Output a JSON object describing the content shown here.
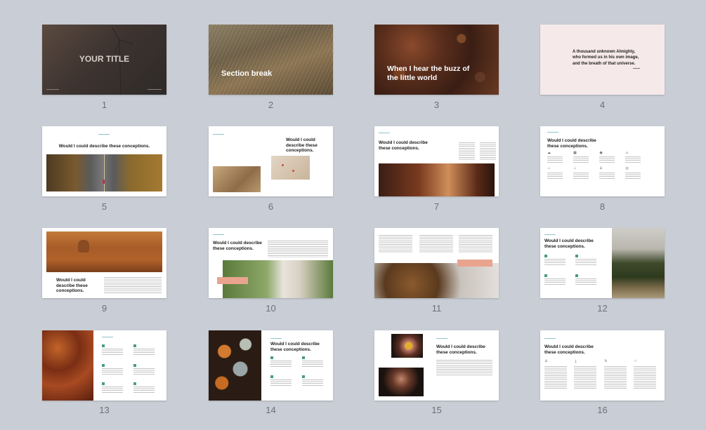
{
  "colors": {
    "background": "#c9ced6",
    "accent": "#4aa9b5",
    "bullet": "#4a9c7a",
    "callout": "#e9a48e"
  },
  "slides": [
    {
      "number": "1",
      "title": "YOUR TITLE"
    },
    {
      "number": "2",
      "title": "Section break"
    },
    {
      "number": "3",
      "title": "When I hear the buzz of the little world"
    },
    {
      "number": "4",
      "quote": "A thousand unknown Almighty, who formed us in his own image, and the breath of that universe."
    },
    {
      "number": "5",
      "heading": "Would I could describe these conceptions."
    },
    {
      "number": "6",
      "heading": "Would I could describe these conceptions."
    },
    {
      "number": "7",
      "heading": "Would I could describe these conceptions."
    },
    {
      "number": "8",
      "heading": "Would I could describe these conceptions."
    },
    {
      "number": "9",
      "heading": "Would I could describe these conceptions."
    },
    {
      "number": "10",
      "heading": "Would I could describe these conceptions."
    },
    {
      "number": "11"
    },
    {
      "number": "12",
      "heading": "Would I could describe these conceptions."
    },
    {
      "number": "13"
    },
    {
      "number": "14",
      "heading": "Would I could describe these conceptions."
    },
    {
      "number": "15",
      "heading": "Would I could describe these conceptions."
    },
    {
      "number": "16",
      "heading": "Would I could describe these conceptions."
    }
  ]
}
